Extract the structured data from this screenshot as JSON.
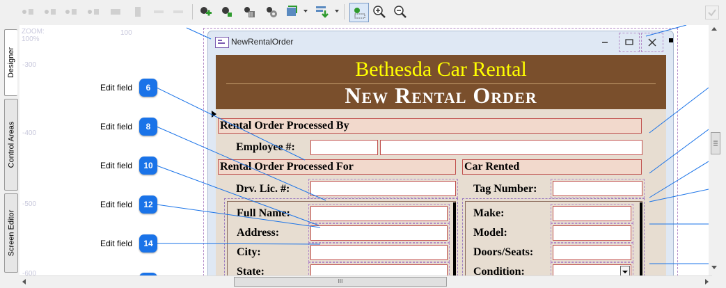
{
  "toolbar": {
    "items": [
      "align-left-icon",
      "align-center-icon",
      "align-right-icon",
      "align-top-icon",
      "align-middle-icon",
      "align-bottom-icon",
      "distribute-icon",
      "same-size-icon",
      "add-control-icon",
      "add-item-icon",
      "delete-icon",
      "properties-icon",
      "layer-icon",
      "order-icon",
      "grid-icon",
      "zoom-in-icon",
      "zoom-out-icon",
      "check-icon"
    ]
  },
  "sidetabs": {
    "designer": "Designer",
    "control_areas": "Control Areas",
    "screen_editor": "Screen Editor"
  },
  "ruler": {
    "zoom_label": "ZOOM:",
    "zoom_value": "100%",
    "top_100": "100",
    "left_300": "-300",
    "left_400": "-400",
    "left_500": "-500",
    "left_600": "-600"
  },
  "callouts": [
    {
      "label": "Edit field",
      "num": "6"
    },
    {
      "label": "Edit field",
      "num": "8"
    },
    {
      "label": "Edit field",
      "num": "10"
    },
    {
      "label": "Edit field",
      "num": "12"
    },
    {
      "label": "Edit field",
      "num": "14"
    }
  ],
  "window": {
    "title": "NewRentalOrder",
    "company": "Bethesda Car Rental",
    "form_title": "New Rental Order"
  },
  "sections": {
    "processed_by": "Rental Order Processed By",
    "processed_for": "Rental Order Processed For",
    "car_rented": "Car Rented"
  },
  "labels": {
    "employee": "Employee #:",
    "drv_lic": "Drv. Lic. #:",
    "tag_number": "Tag Number:",
    "full_name": "Full Name:",
    "address": "Address:",
    "city": "City:",
    "state": "State:",
    "make": "Make:",
    "model": "Model:",
    "doors_seats": "Doors/Seats:",
    "condition": "Condition:"
  },
  "scrollbar": {
    "grip": "III"
  },
  "colors": {
    "header_bg": "#7a4f2c",
    "company": "#ffff00",
    "section_bg": "#f2d9cc",
    "field_border": "#c0504d",
    "badge": "#1a73e8"
  }
}
